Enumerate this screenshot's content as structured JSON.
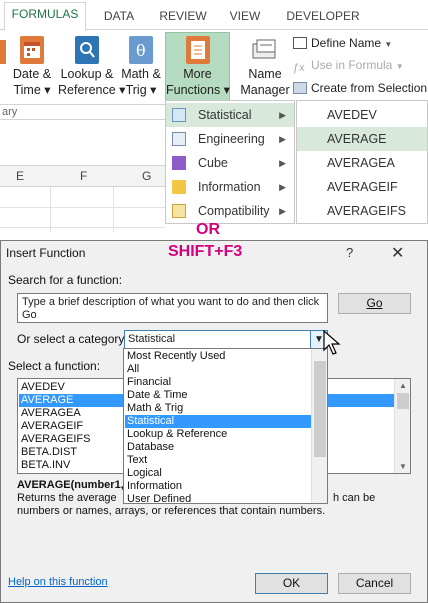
{
  "ribbon": {
    "tabs": [
      "FORMULAS",
      "DATA",
      "REVIEW",
      "VIEW",
      "DEVELOPER"
    ],
    "active_tab": "FORMULAS",
    "commands": [
      {
        "line1": "Date &",
        "line2": "Time ▾"
      },
      {
        "line1": "Lookup &",
        "line2": "Reference ▾"
      },
      {
        "line1": "Math &",
        "line2": "Trig ▾"
      },
      {
        "line1": "More",
        "line2": "Functions ▾"
      },
      {
        "line1": "Name",
        "line2": "Manager"
      }
    ],
    "right_commands": [
      "Define Name",
      "Use in Formula",
      "Create from Selection"
    ],
    "group_label": "ary",
    "columns": [
      "E",
      "F",
      "G"
    ],
    "more_functions_menu": [
      "Statistical",
      "Engineering",
      "Cube",
      "Information",
      "Compatibility"
    ],
    "statistical_submenu": [
      "AVEDEV",
      "AVERAGE",
      "AVERAGEA",
      "AVERAGEIF",
      "AVERAGEIFS"
    ],
    "or_label": "OR"
  },
  "dialog": {
    "title": "Insert Function",
    "shortcut": "SHIFT+F3",
    "help_glyph": "?",
    "close_glyph": "✕",
    "search_label": "Search for a function:",
    "search_text": "Type a brief description of what you want to do and then click Go",
    "go_button": "Go",
    "category_label": "Or select a category:",
    "category_value": "Statistical",
    "categories": [
      "Most Recently Used",
      "All",
      "Financial",
      "Date & Time",
      "Math & Trig",
      "Statistical",
      "Lookup & Reference",
      "Database",
      "Text",
      "Logical",
      "Information",
      "User Defined"
    ],
    "selected_category_index": 5,
    "function_label": "Select a function:",
    "functions": [
      "AVEDEV",
      "AVERAGE",
      "AVERAGEA",
      "AVERAGEIF",
      "AVERAGEIFS",
      "BETA.DIST",
      "BETA.INV"
    ],
    "selected_function_index": 1,
    "syntax": "AVERAGE(number1,n",
    "description_part1": "Returns the average",
    "description_part2": "h can be",
    "description_line2": "numbers or names, arrays, or references that contain numbers.",
    "help_link": "Help on this function",
    "ok_button": "OK",
    "cancel_button": "Cancel"
  },
  "colors": {
    "excel_green": "#217346",
    "highlight_green": "#b5dbc0",
    "magenta": "#d6007f",
    "selection_blue": "#3399ff"
  }
}
